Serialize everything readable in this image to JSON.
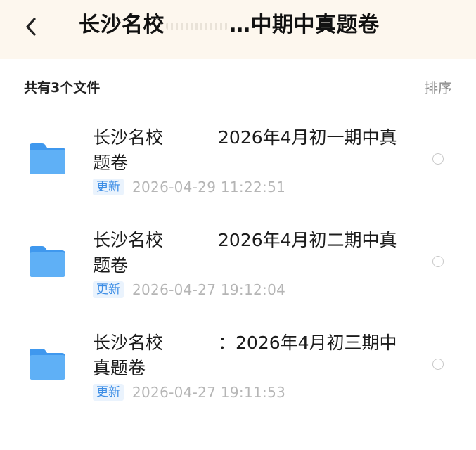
{
  "header": {
    "title_start": "长沙名校",
    "title_end": "…中期中真题卷",
    "back_icon": "chevron-left-icon"
  },
  "toolbar": {
    "count_label": "共有3个文件",
    "sort_label": "排序"
  },
  "files": [
    {
      "name_start": "长沙名校",
      "name_end": "2026年4月初一期中真题卷",
      "badge": "更新",
      "timestamp": "2026-04-29  11:22:51",
      "icon": "folder-icon"
    },
    {
      "name_start": "长沙名校",
      "name_end": "2026年4月初二期中真题卷",
      "badge": "更新",
      "timestamp": "2026-04-27  19:12:04",
      "icon": "folder-icon"
    },
    {
      "name_start": "长沙名校",
      "name_end": "：2026年4月初三期中真题卷",
      "badge": "更新",
      "timestamp": "2026-04-27  19:11:53",
      "icon": "folder-icon"
    }
  ],
  "colors": {
    "header_bg": "#fdf7ee",
    "accent": "#3c8de5",
    "folder": "#4ea4f2"
  }
}
